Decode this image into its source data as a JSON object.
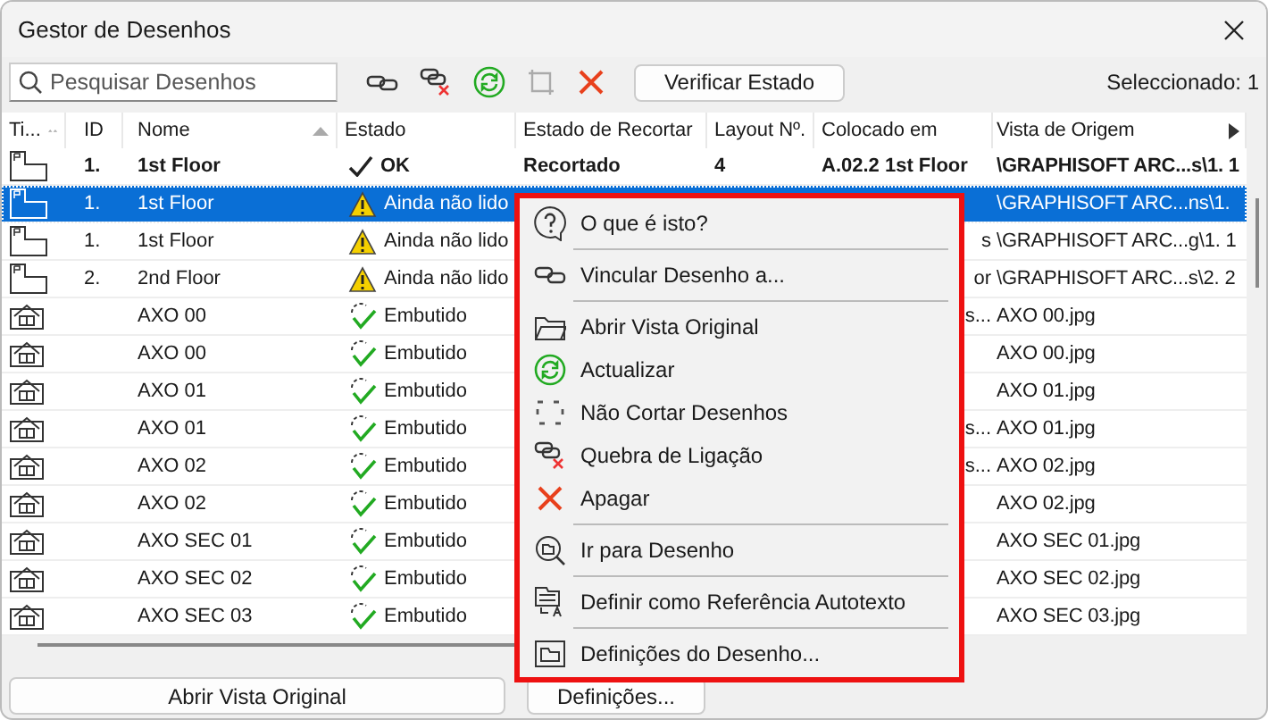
{
  "window": {
    "title": "Gestor de Desenhos"
  },
  "toolbar": {
    "search": {
      "placeholder": "Pesquisar Desenhos"
    },
    "check_button": "Verificar Estado",
    "selection_count": "Seleccionado: 1"
  },
  "table": {
    "columns": [
      {
        "label": "Ti...",
        "kind": "sort-double"
      },
      {
        "label": "ID",
        "kind": "plain"
      },
      {
        "label": "Nome",
        "kind": "sort-single"
      },
      {
        "label": "Estado",
        "kind": "plain"
      },
      {
        "label": "Estado de Recortar",
        "kind": "plain"
      },
      {
        "label": "Layout Nº.",
        "kind": "plain"
      },
      {
        "label": "Colocado em",
        "kind": "plain"
      },
      {
        "label": "Vista de Origem",
        "kind": "plain"
      }
    ],
    "rows": [
      {
        "kind": "layout",
        "id": "1.",
        "name": "1st Floor",
        "status": {
          "kind": "ok",
          "text": "OK"
        },
        "crop": "Recortado",
        "layout": "4",
        "placed": "A.02.2 1st Floor",
        "placed_clipped": false,
        "source": "\\GRAPHISOFT ARC...s\\1. 1",
        "bold": true,
        "selected": false
      },
      {
        "kind": "layout",
        "id": "1.",
        "name": "1st Floor",
        "status": {
          "kind": "warning",
          "text": "Ainda não lido"
        },
        "source": "\\GRAPHISOFT ARC...ns\\1.",
        "bold": false,
        "selected": true
      },
      {
        "kind": "layout",
        "id": "1.",
        "name": "1st Floor",
        "status": {
          "kind": "warning",
          "text": "Ainda não lido"
        },
        "placed": "s",
        "placed_clipped": true,
        "source": "\\GRAPHISOFT ARC...g\\1. 1",
        "bold": false,
        "selected": false
      },
      {
        "kind": "layout",
        "id": "2.",
        "name": "2nd Floor",
        "status": {
          "kind": "warning",
          "text": "Ainda não lido"
        },
        "placed": "or",
        "placed_clipped": true,
        "source": "\\GRAPHISOFT ARC...s\\2. 2",
        "bold": false,
        "selected": false
      },
      {
        "kind": "image",
        "name": "AXO 00",
        "status": {
          "kind": "embedded",
          "text": "Embutido"
        },
        "placed": "s...",
        "placed_clipped": true,
        "source": "AXO 00.jpg",
        "bold": false,
        "selected": false
      },
      {
        "kind": "image",
        "name": "AXO 00",
        "status": {
          "kind": "embedded",
          "text": "Embutido"
        },
        "source": "AXO 00.jpg",
        "bold": false,
        "selected": false
      },
      {
        "kind": "image",
        "name": "AXO 01",
        "status": {
          "kind": "embedded",
          "text": "Embutido"
        },
        "source": "AXO 01.jpg",
        "bold": false,
        "selected": false
      },
      {
        "kind": "image",
        "name": "AXO 01",
        "status": {
          "kind": "embedded",
          "text": "Embutido"
        },
        "placed": "s...",
        "placed_clipped": true,
        "source": "AXO 01.jpg",
        "bold": false,
        "selected": false
      },
      {
        "kind": "image",
        "name": "AXO 02",
        "status": {
          "kind": "embedded",
          "text": "Embutido"
        },
        "placed": "s...",
        "placed_clipped": true,
        "source": "AXO 02.jpg",
        "bold": false,
        "selected": false
      },
      {
        "kind": "image",
        "name": "AXO 02",
        "status": {
          "kind": "embedded",
          "text": "Embutido"
        },
        "source": "AXO 02.jpg",
        "bold": false,
        "selected": false
      },
      {
        "kind": "image",
        "name": "AXO SEC 01",
        "status": {
          "kind": "embedded",
          "text": "Embutido"
        },
        "source": "AXO SEC 01.jpg",
        "bold": false,
        "selected": false
      },
      {
        "kind": "image",
        "name": "AXO SEC 02",
        "status": {
          "kind": "embedded",
          "text": "Embutido"
        },
        "source": "AXO SEC 02.jpg",
        "bold": false,
        "selected": false
      },
      {
        "kind": "image",
        "name": "AXO SEC 03",
        "status": {
          "kind": "embedded",
          "text": "Embutido"
        },
        "source": "AXO SEC 03.jpg",
        "bold": false,
        "selected": false
      }
    ]
  },
  "buttons": [
    "Abrir Vista Original",
    "Definições..."
  ],
  "context_menu": {
    "groups": [
      [
        {
          "kind": "help",
          "label": "O que é isto?"
        }
      ],
      [
        {
          "kind": "link",
          "label": "Vincular Desenho a..."
        }
      ],
      [
        {
          "kind": "folder",
          "label": "Abrir Vista Original"
        },
        {
          "kind": "refresh",
          "label": "Actualizar"
        },
        {
          "kind": "crop",
          "label": "Não Cortar Desenhos"
        },
        {
          "kind": "unlink",
          "label": "Quebra de Ligação"
        },
        {
          "kind": "delete",
          "label": "Apagar"
        }
      ],
      [
        {
          "kind": "goto",
          "label": "Ir para Desenho"
        }
      ],
      [
        {
          "kind": "autotext",
          "label": "Definir como Referência Autotexto"
        }
      ],
      [
        {
          "kind": "settings",
          "label": "Definições do Desenho..."
        }
      ]
    ]
  }
}
